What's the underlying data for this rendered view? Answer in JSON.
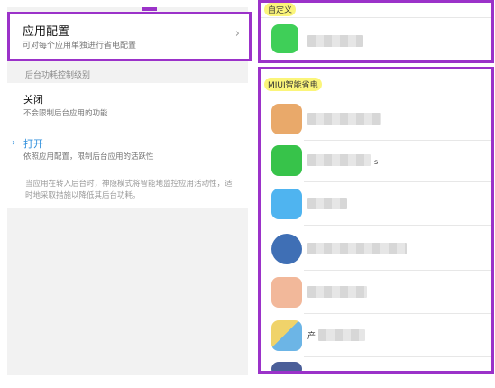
{
  "left": {
    "app_config": {
      "title": "应用配置",
      "subtitle": "可对每个应用单独进行省电配置",
      "chevron": "›"
    },
    "section_label": "后台功耗控制级别",
    "options": [
      {
        "title": "关闭",
        "subtitle": "不会限制后台应用的功能",
        "selected": false
      },
      {
        "title": "打开",
        "subtitle": "依照应用配置，限制后台应用的活跃性",
        "selected": true,
        "check": "›"
      }
    ],
    "description": "当应用在转入后台时，神隐模式将智能地监控应用活动性，适时地采取措施以降低其后台功耗。"
  },
  "right": {
    "custom_label": "自定义",
    "miui_label": "MIUI智能省电",
    "custom_apps": [
      {
        "icon_color": "#3fcf58",
        "name": ""
      }
    ],
    "miui_apps": [
      {
        "icon_color": "#e9a96a",
        "name": ""
      },
      {
        "icon_color": "#37c34a",
        "name": "",
        "note": "s"
      },
      {
        "icon_color": "#4fb4f0",
        "name": ""
      },
      {
        "icon_color": "#3f6fb5",
        "name": ""
      },
      {
        "icon_color": "#f2b89a",
        "name": ""
      },
      {
        "icon_color": "#6cb5e6",
        "name": "产"
      },
      {
        "icon_color": "#4b5f99",
        "name": ""
      }
    ]
  },
  "colors": {
    "highlight_border": "#9b32c9",
    "selected_blue": "#2f8fdc",
    "marker_yellow": "#fbf57a"
  }
}
